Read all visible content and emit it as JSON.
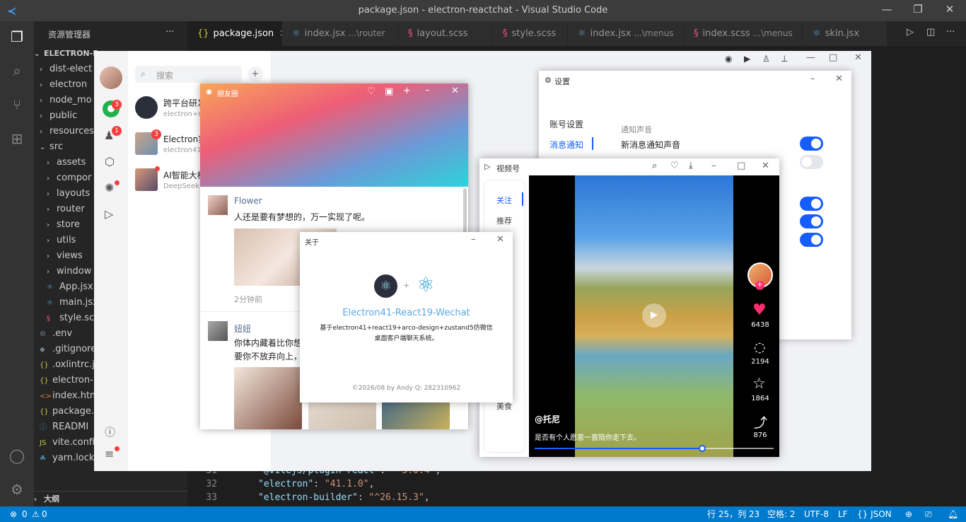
{
  "window": {
    "title": "package.json - electron-reactchat - Visual Studio Code"
  },
  "explorer": {
    "title": "资源管理器",
    "more": "···",
    "project": "ELECTRON-R",
    "items": [
      "dist-elect",
      "electron",
      "node_mo",
      "public",
      "resources",
      "src",
      "assets",
      "compor",
      "layouts",
      "router",
      "store",
      "utils",
      "views",
      "window",
      "App.jsx",
      "main.jsx",
      "style.scs",
      ".env",
      ".gitignore",
      ".oxlintrc.j",
      "electron-",
      "index.htm",
      "package.",
      "READMI",
      "vite.confi",
      "yarn.lock"
    ],
    "outline": "大纲"
  },
  "tabs": [
    {
      "icon": "{}",
      "label": "package.json",
      "sub": "",
      "close": "×"
    },
    {
      "icon": "⚛",
      "label": "index.jsx",
      "sub": "...\\router"
    },
    {
      "icon": "§",
      "label": "layout.scss",
      "sub": ""
    },
    {
      "icon": "§",
      "label": "style.scss",
      "sub": ""
    },
    {
      "icon": "⚛",
      "label": "index.jsx",
      "sub": "...\\menus"
    },
    {
      "icon": "§",
      "label": "index.scss",
      "sub": "...\\menus"
    },
    {
      "icon": "⚛",
      "label": "skin.jsx",
      "sub": ""
    }
  ],
  "code": {
    "lines": [
      {
        "num": "31",
        "key": "\"@vitejs/plugin-react\"",
        "val": "\"^5.0.4\""
      },
      {
        "num": "32",
        "key": "\"electron\"",
        "val": "\"41.1.0\""
      },
      {
        "num": "33",
        "key": "\"electron-builder\"",
        "val": "\"^26.15.3\""
      }
    ]
  },
  "status": {
    "errors": "0",
    "warnings": "0",
    "position": "行 25，列 23",
    "spaces": "空格: 2",
    "encoding": "UTF-8",
    "eol": "LF",
    "language": "{} JSON"
  },
  "app": {
    "search_placeholder": "搜索",
    "plus": "+",
    "nav_badges": [
      "3",
      "1"
    ],
    "chats": [
      {
        "name": "跨平台研发",
        "preview": "electron+re"
      },
      {
        "name": "Electron实",
        "preview": "electron41-",
        "badge": "3"
      },
      {
        "name": "AI智能大模",
        "preview": "DeepSeek-"
      }
    ]
  },
  "moments": {
    "title": "朋友圈",
    "posts": [
      {
        "author": "Flower",
        "text": "人还是要有梦想的，万一实现了呢。",
        "time": "2分钟前"
      },
      {
        "author": "妞妞",
        "text": "你体内藏着比你想",
        "text2": "要你不放弃向上，"
      }
    ]
  },
  "about": {
    "title": "关于",
    "plus": "+",
    "app_name": "Electron41-React19-Wechat",
    "desc1": "基于electron41+react19+arco-design+zustand5仿微信",
    "desc2": "桌面客户端聊天系统。",
    "footer": "©2026/08 by Andy  Q: 282310962"
  },
  "settings": {
    "title": "设置",
    "menu": [
      "账号设置",
      "消息通知"
    ],
    "section": "通知声音",
    "item": "新消息通知声音",
    "toggles": [
      true,
      false,
      true,
      true,
      true
    ]
  },
  "video": {
    "title": "视频号",
    "tabs": [
      "关注",
      "推荐",
      "美食"
    ],
    "user": "@托尼",
    "caption": "是否有个人愿意一直陪你走下去。",
    "likes": "6438",
    "comments": "2194",
    "stars": "1864",
    "shares": "876",
    "progress": 0.7
  }
}
